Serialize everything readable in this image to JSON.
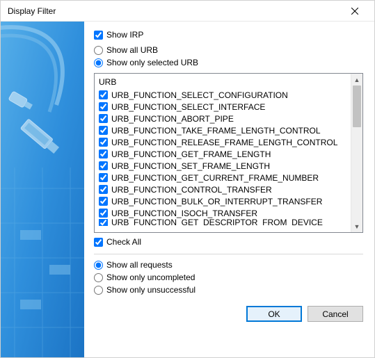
{
  "window": {
    "title": "Display Filter"
  },
  "irp": {
    "show_irp_label": "Show IRP",
    "show_irp_checked": true
  },
  "urb_mode": {
    "show_all_label": "Show all URB",
    "show_selected_label": "Show only selected URB",
    "selected": "show_selected"
  },
  "urb_list": {
    "header": "URB",
    "items": [
      {
        "label": "URB_FUNCTION_SELECT_CONFIGURATION",
        "checked": true
      },
      {
        "label": "URB_FUNCTION_SELECT_INTERFACE",
        "checked": true
      },
      {
        "label": "URB_FUNCTION_ABORT_PIPE",
        "checked": true
      },
      {
        "label": "URB_FUNCTION_TAKE_FRAME_LENGTH_CONTROL",
        "checked": true
      },
      {
        "label": "URB_FUNCTION_RELEASE_FRAME_LENGTH_CONTROL",
        "checked": true
      },
      {
        "label": "URB_FUNCTION_GET_FRAME_LENGTH",
        "checked": true
      },
      {
        "label": "URB_FUNCTION_SET_FRAME_LENGTH",
        "checked": true
      },
      {
        "label": "URB_FUNCTION_GET_CURRENT_FRAME_NUMBER",
        "checked": true
      },
      {
        "label": "URB_FUNCTION_CONTROL_TRANSFER",
        "checked": true
      },
      {
        "label": "URB_FUNCTION_BULK_OR_INTERRUPT_TRANSFER",
        "checked": true
      },
      {
        "label": "URB_FUNCTION_ISOCH_TRANSFER",
        "checked": true
      },
      {
        "label": "URB_FUNCTION_GET_DESCRIPTOR_FROM_DEVICE",
        "checked": true
      }
    ]
  },
  "check_all": {
    "label": "Check All",
    "checked": true
  },
  "requests": {
    "show_all_label": "Show all requests",
    "show_uncompleted_label": "Show only uncompleted",
    "show_unsuccessful_label": "Show only unsuccessful",
    "selected": "show_all"
  },
  "buttons": {
    "ok": "OK",
    "cancel": "Cancel"
  }
}
